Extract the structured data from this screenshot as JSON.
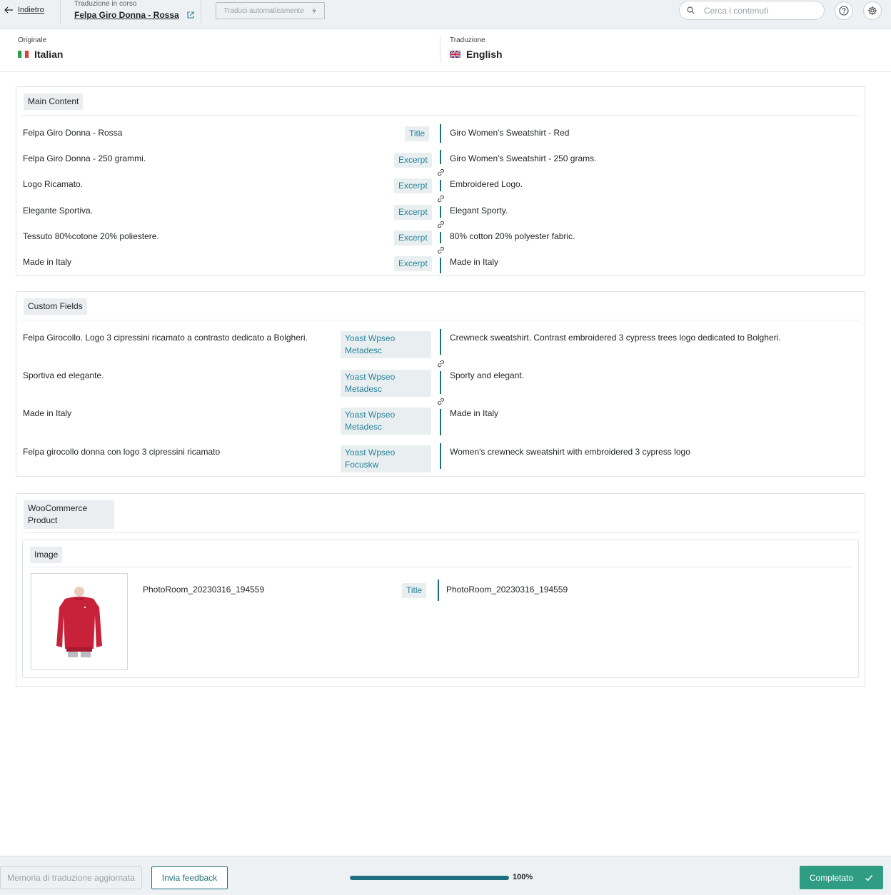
{
  "header": {
    "back_label": "Indietro",
    "subtitle": "Traduzione in corso",
    "title": "Felpa Giro Donna - Rossa",
    "auto_translate_label": "Traduci automaticamente",
    "search_placeholder": "Cerca i contenuti"
  },
  "languages": {
    "original_label": "Originale",
    "original_value": "Italian",
    "translation_label": "Traduzione",
    "translation_value": "English"
  },
  "main_content": {
    "title": "Main Content",
    "rows": [
      {
        "source": "Felpa Giro Donna - Rossa",
        "tag": "Title",
        "target": "Giro Women's Sweatshirt - Red"
      },
      {
        "source": "Felpa Giro Donna - 250 grammi.",
        "tag": "Excerpt",
        "target": "Giro Women's Sweatshirt - 250 grams."
      },
      {
        "source": "Logo Ricamato.",
        "tag": "Excerpt",
        "target": "Embroidered Logo."
      },
      {
        "source": "Elegante Sportiva.",
        "tag": "Excerpt",
        "target": "Elegant Sporty."
      },
      {
        "source": "Tessuto 80%cotone 20% poliestere.",
        "tag": "Excerpt",
        "target": "80% cotton 20% polyester fabric."
      },
      {
        "source": "Made in Italy",
        "tag": "Excerpt",
        "target": "Made in Italy"
      }
    ]
  },
  "custom_fields": {
    "title": "Custom Fields",
    "rows": [
      {
        "source": "Felpa Girocollo. Logo 3 cipressini ricamato a contrasto dedicato a Bolgheri.",
        "tag_line1": "Yoast Wpseo",
        "tag_line2": "Metadesc",
        "target": "Crewneck sweatshirt. Contrast embroidered 3 cypress trees logo dedicated to Bolgheri."
      },
      {
        "source": "Sportiva ed elegante.",
        "tag_line1": "Yoast Wpseo",
        "tag_line2": "Metadesc",
        "target": "Sporty and elegant."
      },
      {
        "source": "Made in Italy",
        "tag_line1": "Yoast Wpseo",
        "tag_line2": "Metadesc",
        "target": "Made in Italy"
      },
      {
        "source": "Felpa girocollo donna con logo 3 cipressini ricamato",
        "tag_line1": "Yoast Wpseo",
        "tag_line2": "Focuskw",
        "target": "Women's crewneck sweatshirt with embroidered 3 cypress logo"
      }
    ]
  },
  "woocommerce": {
    "title_line1": "WooCommerce",
    "title_line2": "Product",
    "image": {
      "title": "Image",
      "source": "PhotoRoom_20230316_194559",
      "tag": "Title",
      "target": "PhotoRoom_20230316_194559"
    }
  },
  "footer": {
    "tm_label": "Memoria di traduzione aggiornata",
    "feedback_label": "Invia feedback",
    "progress_value": 1.0,
    "progress_text": "100%",
    "complete_label": "Completato"
  },
  "colors": {
    "accent": "#1d6f7d",
    "success": "#2e9d83",
    "tag_text": "#27839a"
  }
}
